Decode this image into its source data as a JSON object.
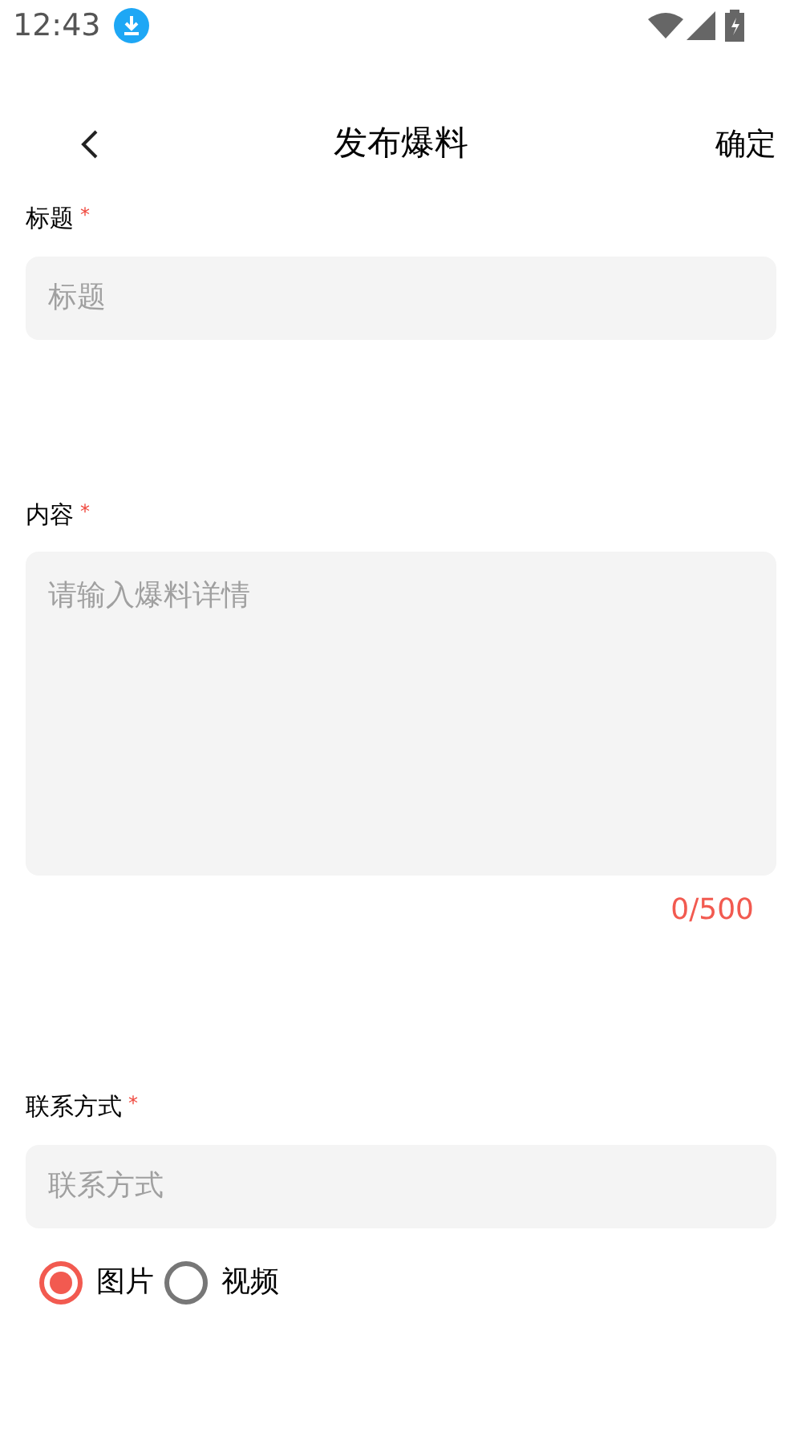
{
  "status_bar": {
    "time": "12:43"
  },
  "header": {
    "title": "发布爆料",
    "action": "确定"
  },
  "fields": [
    {
      "kind": "input",
      "label": "标题",
      "required": "*",
      "placeholder": "标题"
    },
    {
      "kind": "textarea",
      "label": "内容",
      "required": "*",
      "placeholder": "请输入爆料详情",
      "counter": "0/500"
    },
    {
      "kind": "input",
      "label": "联系方式",
      "required": "*",
      "placeholder": "联系方式"
    }
  ],
  "media_type": [
    {
      "label": "图片",
      "selected": true
    },
    {
      "label": "视频",
      "selected": false
    }
  ]
}
